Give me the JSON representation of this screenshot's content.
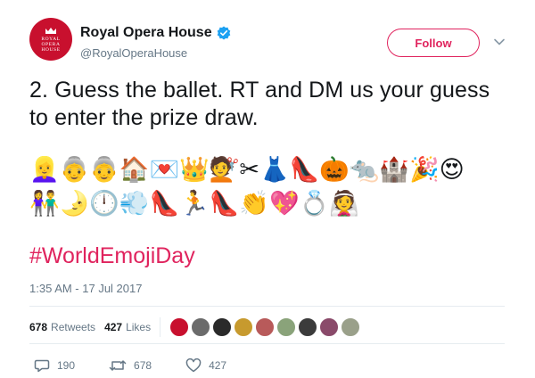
{
  "account": {
    "display_name": "Royal Opera House",
    "handle": "@RoyalOperaHouse",
    "avatar_lines": [
      "ROYAL",
      "OPERA",
      "HOUSE"
    ]
  },
  "follow_label": "Follow",
  "tweet": {
    "line1": "2. Guess the ballet. RT and DM us your guess",
    "line2": "to enter the prize draw.",
    "emoji_row1": "👱‍♀️👵👵🏠💌👑💇✂👗👠🎃🐀🏰🎉😍",
    "emoji_row2": "👫🌛🕛💨👠🏃👠👏💖💍👰",
    "hashtag": "#WorldEmojiDay",
    "timestamp": "1:35 AM - 17 Jul 2017"
  },
  "stats": {
    "retweets_count": "678",
    "retweets_label": "Retweets",
    "likes_count": "427",
    "likes_label": "Likes"
  },
  "liker_avatar_colors": [
    "#c8102e",
    "#6b6b6b",
    "#2a2a2a",
    "#c79a2e",
    "#b85a5a",
    "#8aa37a",
    "#3b3b3b",
    "#8a4a6a",
    "#9aa08a"
  ],
  "actions": {
    "replies": "190",
    "retweets": "678",
    "likes": "427"
  },
  "colors": {
    "accent": "#e0245e",
    "verified": "#1da1f2",
    "muted": "#657786"
  }
}
